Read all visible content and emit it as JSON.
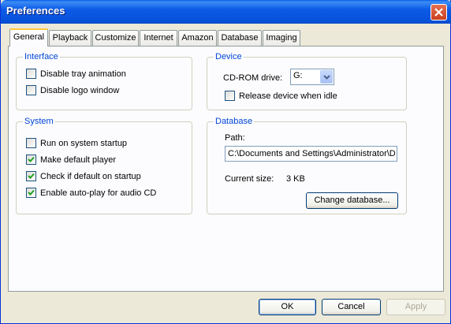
{
  "window": {
    "title": "Preferences"
  },
  "tabs": [
    {
      "label": "General"
    },
    {
      "label": "Playback"
    },
    {
      "label": "Customize"
    },
    {
      "label": "Internet"
    },
    {
      "label": "Amazon"
    },
    {
      "label": "Database"
    },
    {
      "label": "Imaging"
    }
  ],
  "interface": {
    "title": "Interface",
    "disable_tray_animation": {
      "label": "Disable tray animation",
      "checked": false
    },
    "disable_logo_window": {
      "label": "Disable logo window",
      "checked": false
    }
  },
  "device": {
    "title": "Device",
    "cdrom_label": "CD-ROM drive:",
    "cdrom_value": "G:",
    "release_device": {
      "label": "Release device when idle",
      "checked": false
    }
  },
  "system": {
    "title": "System",
    "run_on_startup": {
      "label": "Run on system startup",
      "checked": false
    },
    "make_default": {
      "label": "Make default player",
      "checked": true
    },
    "check_default": {
      "label": "Check if default on startup",
      "checked": true
    },
    "autoplay": {
      "label": "Enable auto-play for audio CD",
      "checked": true
    }
  },
  "database": {
    "title": "Database",
    "path_label": "Path:",
    "path_value": "C:\\Documents and Settings\\Administrator\\D",
    "size_label": "Current size:",
    "size_value": "3 KB",
    "change_button": "Change database..."
  },
  "footer": {
    "ok": "OK",
    "cancel": "Cancel",
    "apply": "Apply"
  }
}
